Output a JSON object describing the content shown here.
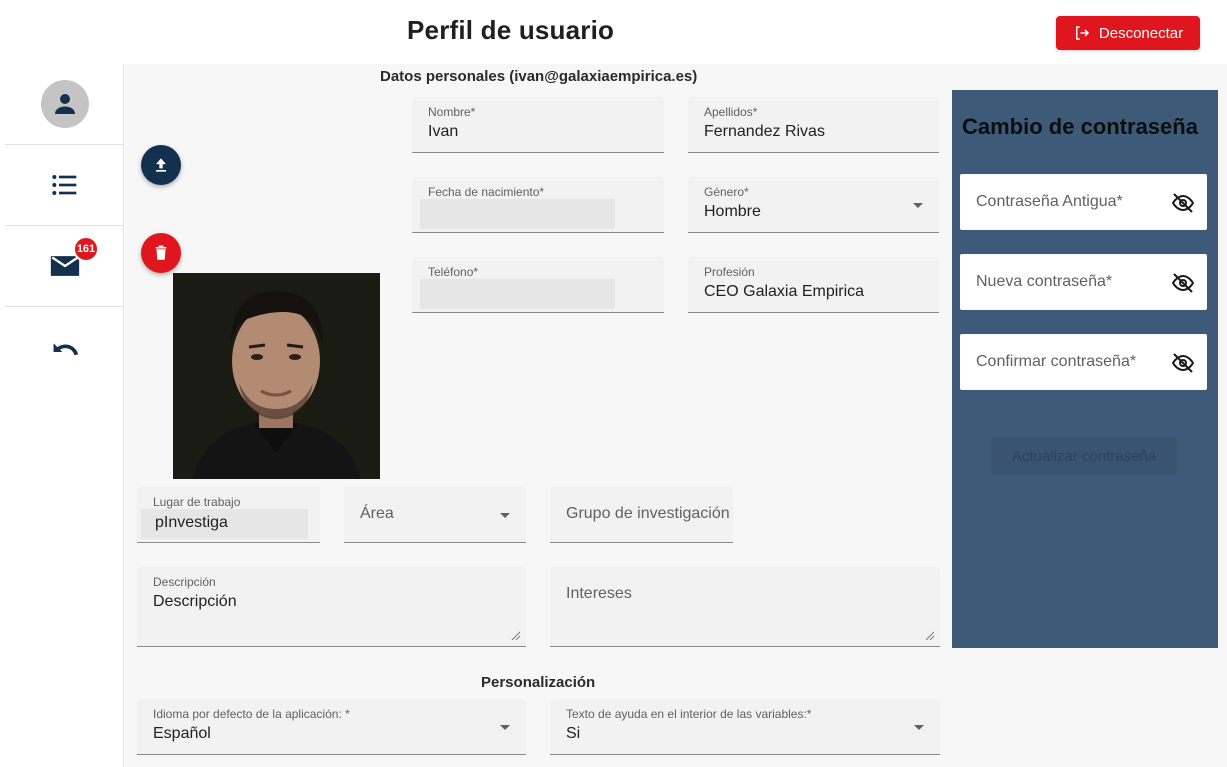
{
  "header": {
    "title": "Perfil de usuario",
    "logout_label": "Desconectar"
  },
  "sidebar": {
    "mail_badge": "161"
  },
  "personal": {
    "section_title": "Datos personales (ivan@galaxiaempirica.es)",
    "nombre": {
      "label": "Nombre*",
      "value": "Ivan"
    },
    "apellidos": {
      "label": "Apellidos*",
      "value": "Fernandez Rivas"
    },
    "fecha": {
      "label": "Fecha de nacimiento*",
      "value": ""
    },
    "genero": {
      "label": "Género*",
      "value": "Hombre"
    },
    "telefono": {
      "label": "Teléfono*",
      "value": ""
    },
    "profesion": {
      "label": "Profesión",
      "value": "CEO Galaxia Empirica"
    },
    "lugar": {
      "label": "Lugar de trabajo",
      "value": "pInvestiga"
    },
    "area": {
      "placeholder": "Área"
    },
    "grupo": {
      "placeholder": "Grupo de investigación"
    },
    "descripcion": {
      "label": "Descripción",
      "value": "Descripción"
    },
    "intereses": {
      "placeholder": "Intereses"
    }
  },
  "personalizacion": {
    "section_title": "Personalización",
    "idioma": {
      "label": "Idioma por defecto de la aplicación: *",
      "value": "Español"
    },
    "ayuda": {
      "label": "Texto de ayuda en el interior de las variables:*",
      "value": "Si"
    }
  },
  "password": {
    "title": "Cambio de contraseña",
    "old": "Contraseña Antigua*",
    "new": "Nueva contraseña*",
    "confirm": "Confirmar contraseña*",
    "submit": "Actualizar contraseña"
  },
  "colors": {
    "accent_red": "#e0161e",
    "navy": "#13304e",
    "panel": "#3d5a78"
  }
}
